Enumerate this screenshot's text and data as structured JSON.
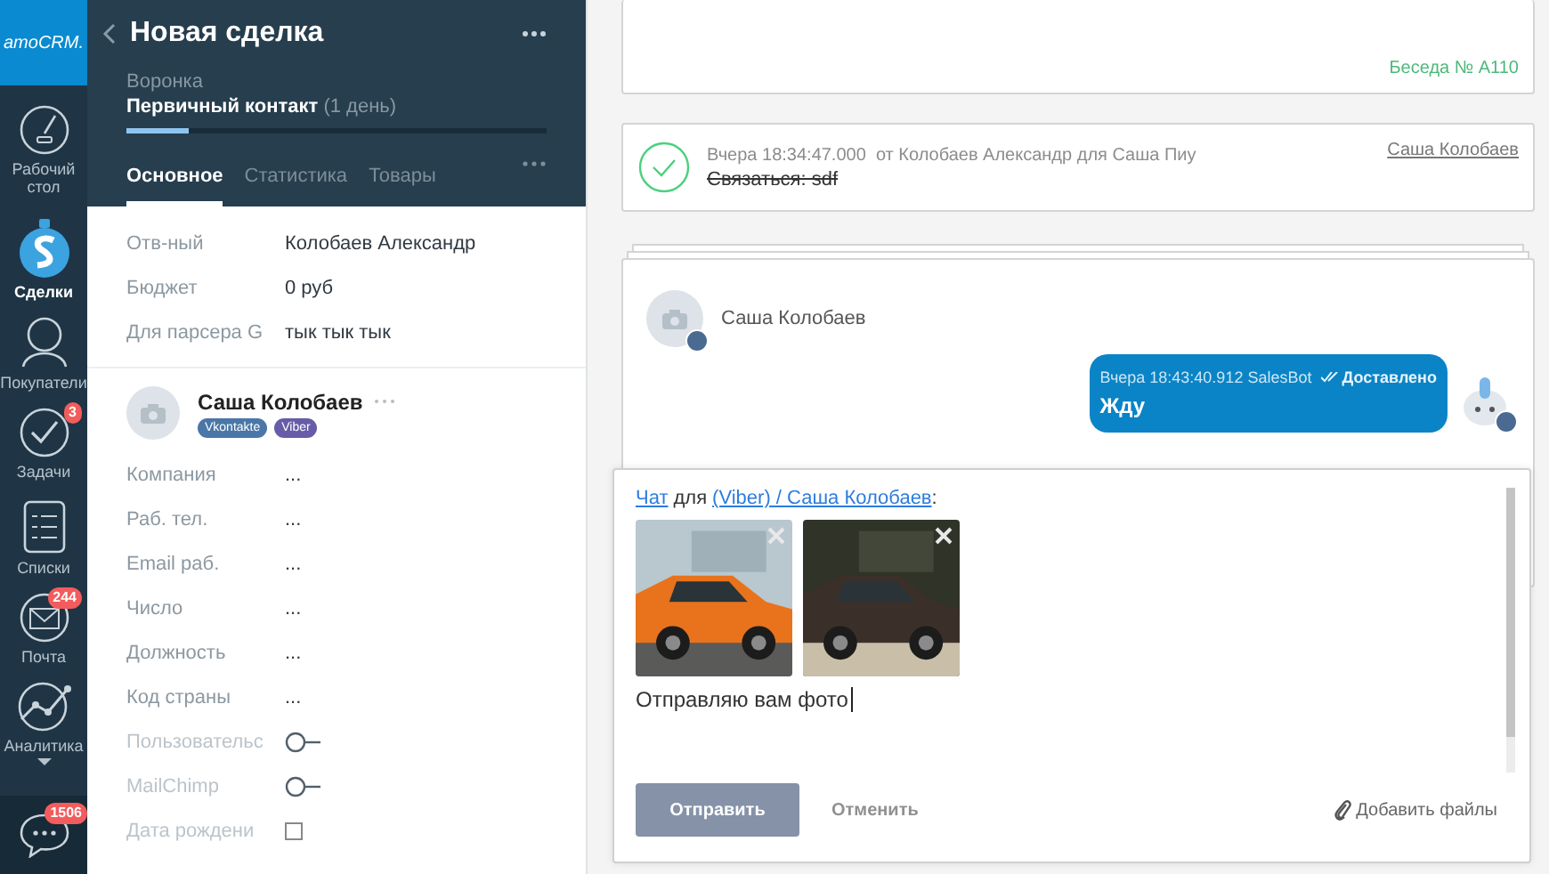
{
  "nav": {
    "logo": "amoCRM.",
    "items": [
      {
        "kind": "dashboard",
        "label": "Рабочий стол",
        "selected": false
      },
      {
        "kind": "deals",
        "label": "Сделки",
        "selected": true
      },
      {
        "kind": "buyers",
        "label": "Покупатели",
        "selected": false
      },
      {
        "kind": "tasks",
        "label": "Задачи",
        "selected": false,
        "badge": "3"
      },
      {
        "kind": "lists",
        "label": "Списки",
        "selected": false
      },
      {
        "kind": "mail",
        "label": "Почта",
        "selected": false,
        "badge": "244"
      },
      {
        "kind": "analytics",
        "label": "Аналитика",
        "selected": false
      }
    ],
    "chat_badge": "1506"
  },
  "deal": {
    "title": "Новая сделка",
    "pipeline_label": "Воронка",
    "stage": "Первичный контакт",
    "stage_duration": "(1 день)",
    "level": 0.15,
    "tabs": [
      {
        "label": "Основное",
        "selected": true
      },
      {
        "label": "Статистика",
        "selected": false
      },
      {
        "label": "Товары",
        "selected": false
      }
    ],
    "fields": [
      {
        "label": "Отв-ный",
        "value": "Колобаев Александр"
      },
      {
        "label": "Бюджет",
        "value": "0 руб"
      },
      {
        "label": "Для парсера G",
        "value": "тык тык тык"
      }
    ]
  },
  "contact": {
    "name": "Саша Колобаев",
    "channels": [
      {
        "label": "Vkontakte",
        "color": "#4a76a8"
      },
      {
        "label": "Viber",
        "color": "#665ca7"
      }
    ],
    "fields": [
      {
        "kind": "text",
        "label": "Компания",
        "value": "...",
        "disabled": false
      },
      {
        "kind": "text",
        "label": "Раб. тел.",
        "value": "...",
        "disabled": false
      },
      {
        "kind": "text",
        "label": "Email раб.",
        "value": "...",
        "disabled": false
      },
      {
        "kind": "text",
        "label": "Число",
        "value": "...",
        "disabled": false
      },
      {
        "kind": "text",
        "label": "Должность",
        "value": "...",
        "disabled": false
      },
      {
        "kind": "text",
        "label": "Код страны",
        "value": "...",
        "disabled": false
      },
      {
        "kind": "toggle",
        "label": "Пользовательс",
        "disabled": true
      },
      {
        "kind": "toggle",
        "label": "MailChimp",
        "disabled": true
      },
      {
        "kind": "checkbox",
        "label": "Дата рождени",
        "disabled": true,
        "checked": false
      }
    ]
  },
  "feed": [
    {
      "kind": "conversation_end",
      "tag": "Беседа № A110"
    },
    {
      "kind": "task",
      "done": true,
      "meta": "Вчера 18:34:47.000  от Колобаев Александр для Саша Пиу",
      "text": "Связаться: sdf",
      "link": "Саша Колобаев"
    },
    {
      "kind": "chat",
      "contact": "Саша Колобаев",
      "message": {
        "meta": "Вчера 18:43:40.912 SalesBot",
        "status": "Доставлено",
        "text": "Жду"
      }
    }
  ],
  "composer": {
    "chat_link": "Чат",
    "joiner": "для",
    "target_link": "(Viber) / Саша Колобаев",
    "suffix": ":",
    "value": "Отправляю вам фото",
    "send": "Отправить",
    "cancel": "Отменить",
    "attach": "Добавить файлы"
  }
}
